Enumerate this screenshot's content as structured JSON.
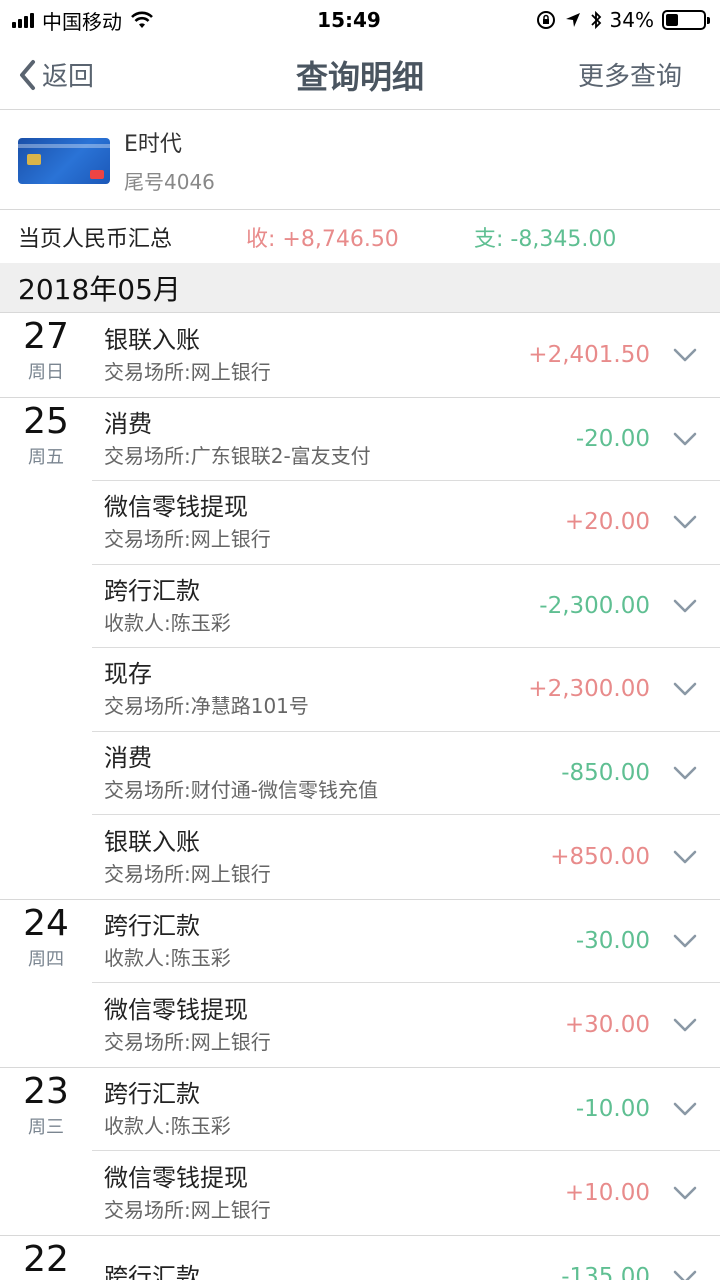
{
  "status_bar": {
    "carrier": "中国移动",
    "time": "15:49",
    "battery": "34%",
    "battery_level": 0.34
  },
  "nav": {
    "back_label": "返回",
    "title": "查询明细",
    "more_label": "更多查询"
  },
  "card": {
    "name": "E时代",
    "tail": "尾号4046"
  },
  "summary": {
    "label": "当页人民币汇总",
    "income": "收: +8,746.50",
    "expense": "支: -8,345.00"
  },
  "month": "2018年05月",
  "days": [
    {
      "day": "27",
      "weekday": "周日",
      "transactions": [
        {
          "title": "银联入账",
          "sub": "交易场所:网上银行",
          "amount": "+2,401.50",
          "type": "pos"
        }
      ]
    },
    {
      "day": "25",
      "weekday": "周五",
      "transactions": [
        {
          "title": "消费",
          "sub": "交易场所:广东银联2-富友支付",
          "amount": "-20.00",
          "type": "neg"
        },
        {
          "title": "微信零钱提现",
          "sub": "交易场所:网上银行",
          "amount": "+20.00",
          "type": "pos"
        },
        {
          "title": "跨行汇款",
          "sub": "收款人:陈玉彩",
          "amount": "-2,300.00",
          "type": "neg"
        },
        {
          "title": "现存",
          "sub": "交易场所:净慧路101号",
          "amount": "+2,300.00",
          "type": "pos"
        },
        {
          "title": "消费",
          "sub": "交易场所:财付通-微信零钱充值",
          "amount": "-850.00",
          "type": "neg"
        },
        {
          "title": "银联入账",
          "sub": "交易场所:网上银行",
          "amount": "+850.00",
          "type": "pos"
        }
      ]
    },
    {
      "day": "24",
      "weekday": "周四",
      "transactions": [
        {
          "title": "跨行汇款",
          "sub": "收款人:陈玉彩",
          "amount": "-30.00",
          "type": "neg"
        },
        {
          "title": "微信零钱提现",
          "sub": "交易场所:网上银行",
          "amount": "+30.00",
          "type": "pos"
        }
      ]
    },
    {
      "day": "23",
      "weekday": "周三",
      "transactions": [
        {
          "title": "跨行汇款",
          "sub": "收款人:陈玉彩",
          "amount": "-10.00",
          "type": "neg"
        },
        {
          "title": "微信零钱提现",
          "sub": "交易场所:网上银行",
          "amount": "+10.00",
          "type": "pos"
        }
      ]
    },
    {
      "day": "22",
      "weekday": "",
      "transactions": [
        {
          "title": "跨行汇款",
          "sub": "",
          "amount": "-135.00",
          "type": "neg"
        }
      ]
    }
  ]
}
